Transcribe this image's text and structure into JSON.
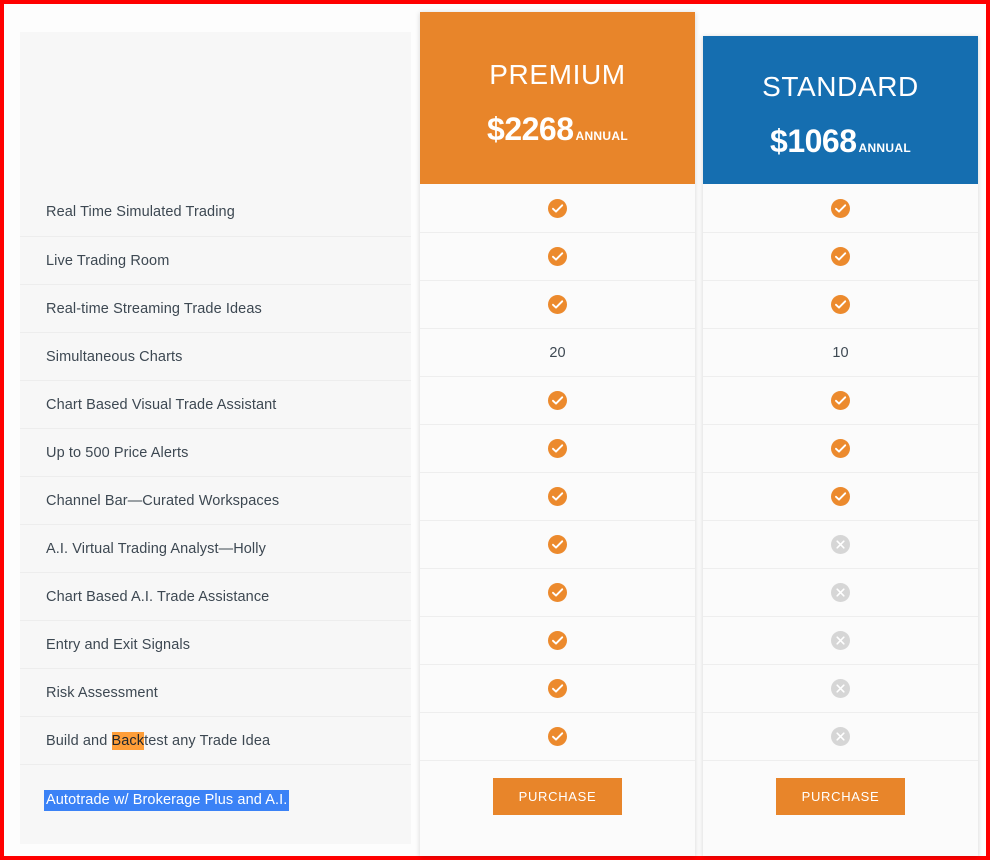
{
  "table": {
    "feature_column_header": "",
    "features": [
      "Real Time Simulated Trading",
      "Live Trading Room",
      "Real-time Streaming Trade Ideas",
      "Simultaneous Charts",
      "Chart Based Visual Trade Assistant",
      "Up to 500 Price Alerts",
      "Channel Bar—Curated Workspaces",
      "A.I. Virtual Trading Analyst—Holly",
      "Chart Based A.I. Trade Assistance",
      "Entry and Exit Signals",
      "Risk Assessment",
      "Build and Backtest any Trade Idea",
      "Autotrade w/ Brokerage Plus and A.I."
    ],
    "highlights": {
      "find_match_row_index": 11,
      "find_match_prefix": "Build and ",
      "find_match_text": "Back",
      "find_match_suffix": "test any Trade Idea",
      "find_match_color": "#ff9e38",
      "selected_row_index": 12,
      "selected_text": "Autotrade w/ Brokerage Plus and A.I.",
      "selection_color": "#3b82f6",
      "selection_text_color": "#ffffff"
    }
  },
  "plans": [
    {
      "id": "premium",
      "name": "PREMIUM",
      "price": "$2268",
      "period": "ANNUAL",
      "header_color": "#e8852a",
      "cta_label": "PURCHASE",
      "cta_color": "#e8852a",
      "values": [
        "yes",
        "yes",
        "yes",
        "20",
        "yes",
        "yes",
        "yes",
        "yes",
        "yes",
        "yes",
        "yes",
        "yes"
      ]
    },
    {
      "id": "standard",
      "name": "STANDARD",
      "price": "$1068",
      "period": "ANNUAL",
      "header_color": "#156eb0",
      "cta_label": "PURCHASE",
      "cta_color": "#e8852a",
      "values": [
        "yes",
        "yes",
        "yes",
        "10",
        "yes",
        "yes",
        "yes",
        "no",
        "no",
        "no",
        "no",
        "no"
      ]
    }
  ],
  "icons": {
    "yes": "check-circle-icon",
    "no": "x-circle-icon",
    "yes_color": "#ec8a2d",
    "no_color": "#d6d6d6"
  },
  "border": {
    "color": "#ff0000"
  }
}
